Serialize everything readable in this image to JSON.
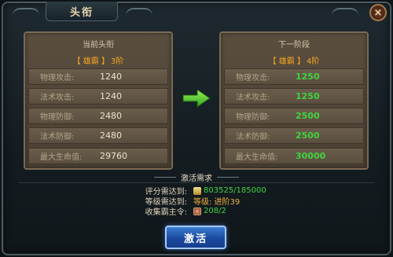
{
  "window": {
    "title": "头衔",
    "close_label": "×"
  },
  "current": {
    "heading": "当前头衔",
    "rank_name": "【 雄霸 】",
    "rank_level": "3阶",
    "stats": [
      {
        "label": "物理攻击:",
        "value": "1240"
      },
      {
        "label": "法术攻击:",
        "value": "1240"
      },
      {
        "label": "物理防御:",
        "value": "2480"
      },
      {
        "label": "法术防御:",
        "value": "2480"
      },
      {
        "label": "最大生命值:",
        "value": "29760"
      }
    ]
  },
  "next": {
    "heading": "下一阶段",
    "rank_name": "【 雄霸 】",
    "rank_level": "4阶",
    "stats": [
      {
        "label": "物理攻击:",
        "value": "1250"
      },
      {
        "label": "法术攻击:",
        "value": "1250"
      },
      {
        "label": "物理防御:",
        "value": "2500"
      },
      {
        "label": "法术防御:",
        "value": "2500"
      },
      {
        "label": "最大生命值:",
        "value": "30000"
      }
    ]
  },
  "requirements": {
    "title": "激活需求",
    "rows": [
      {
        "label": "评分需达到:",
        "value": "803525/185000",
        "icon": "score-icon"
      },
      {
        "label": "等级需达到:",
        "value": "等级: 进阶39",
        "icon": ""
      },
      {
        "label": "收集霸主令:",
        "value": "208/2",
        "icon": "token-icon"
      }
    ]
  },
  "activate_button": {
    "label": "激活"
  },
  "colors": {
    "accent_green": "#3fd43f",
    "rank_orange": "#f5a623",
    "button_blue": "#1b4aa0"
  }
}
